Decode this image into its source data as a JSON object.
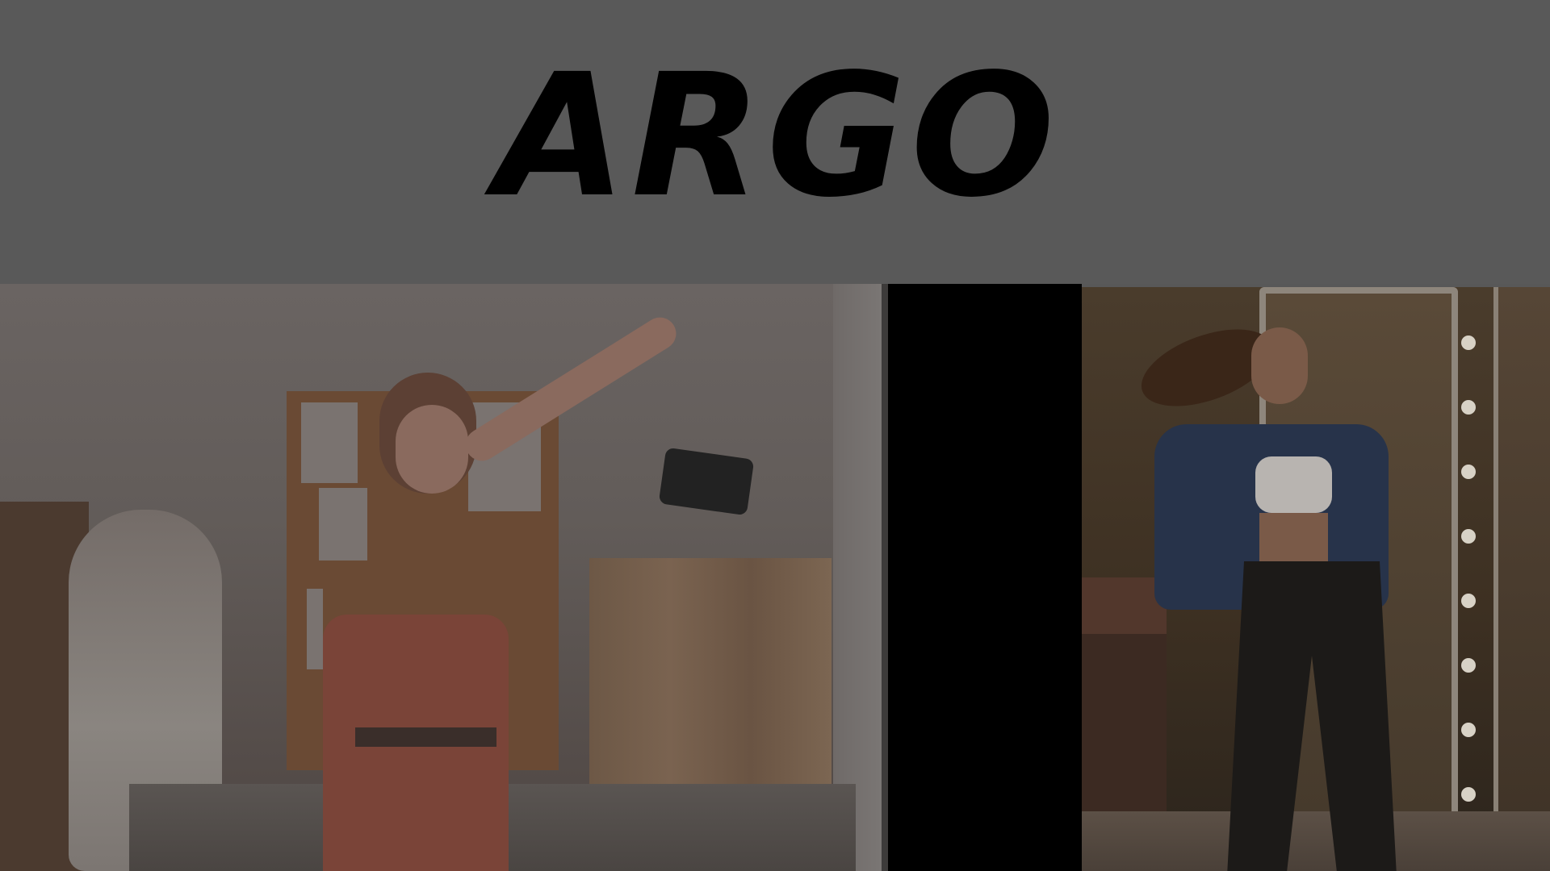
{
  "header": {
    "logo_text": "ARGO"
  },
  "gallery": {
    "images": [
      {
        "name": "designer-selfie-photo"
      },
      {
        "name": "blank-black-panel"
      },
      {
        "name": "mirror-pose-photo"
      }
    ]
  },
  "colors": {
    "page_background": "#585858",
    "logo_color": "#000000",
    "middle_panel": "#000000"
  }
}
